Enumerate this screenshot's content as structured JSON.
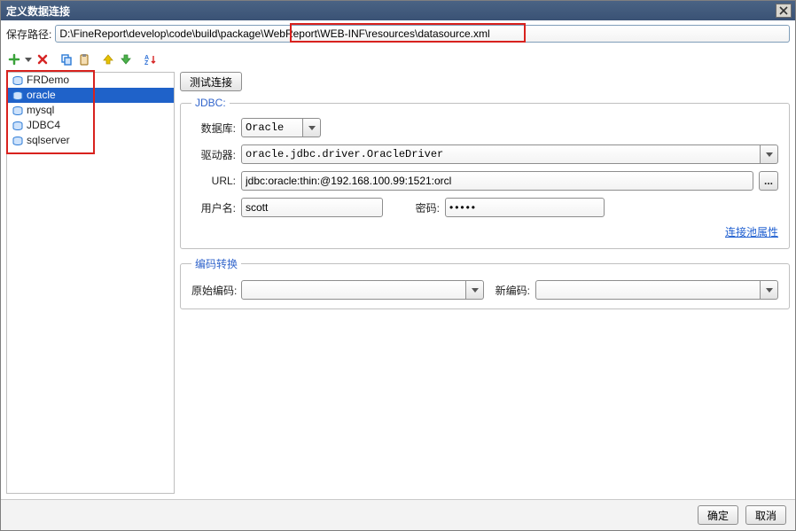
{
  "window": {
    "title": "定义数据连接",
    "close_tooltip": "关闭"
  },
  "path": {
    "label": "保存路径:",
    "value": "D:\\FineReport\\develop\\code\\build\\package\\WebReport\\WEB-INF\\resources\\datasource.xml"
  },
  "toolbar": {
    "add": "新增",
    "remove": "删除",
    "copy": "复制",
    "paste": "粘贴",
    "moveup": "上移",
    "movedown": "下移",
    "sort": "排序"
  },
  "datasources": {
    "items": [
      {
        "name": "FRDemo"
      },
      {
        "name": "oracle"
      },
      {
        "name": "mysql"
      },
      {
        "name": "JDBC4"
      },
      {
        "name": "sqlserver"
      }
    ],
    "selected_index": 1
  },
  "actions": {
    "test_connect": "测试连接"
  },
  "jdbc": {
    "legend": "JDBC:",
    "database_label": "数据库:",
    "database_value": "Oracle",
    "driver_label": "驱动器:",
    "driver_value": "oracle.jdbc.driver.OracleDriver",
    "url_label": "URL:",
    "url_value": "jdbc:oracle:thin:@192.168.100.99:1521:orcl",
    "url_browse": "...",
    "user_label": "用户名:",
    "user_value": "scott",
    "password_label": "密码:",
    "password_value": "•••••",
    "pool_props": "连接池属性"
  },
  "encoding": {
    "legend": "编码转换",
    "orig_label": "原始编码:",
    "orig_value": "",
    "new_label": "新编码:",
    "new_value": ""
  },
  "footer": {
    "ok": "确定",
    "cancel": "取消"
  }
}
